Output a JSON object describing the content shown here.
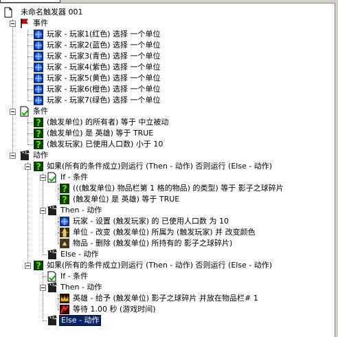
{
  "window": {
    "title": ""
  },
  "tree": {
    "root": {
      "label": "未命名触发器 001"
    },
    "events": {
      "label": "事件",
      "items": [
        "玩家 - 玩家1(红色) 选择 一个单位",
        "玩家 - 玩家2(蓝色) 选择 一个单位",
        "玩家 - 玩家3(青色) 选择 一个单位",
        "玩家 - 玩家4(紫色) 选择 一个单位",
        "玩家 - 玩家5(黄色) 选择 一个单位",
        "玩家 - 玩家6(橙色) 选择 一个单位",
        "玩家 - 玩家7(绿色) 选择 一个单位"
      ]
    },
    "conditions": {
      "label": "条件",
      "items": [
        "(触发单位) 的所有者) 等于 中立被动",
        "(触发单位) 是 英雄) 等于 TRUE",
        "(触发玩家) 已使用人口数) 小于 10"
      ]
    },
    "actions": {
      "label": "动作",
      "if1": {
        "label": "如果(所有的条件成立)则运行 (Then - 动作) 否则运行 (Else - 动作)",
        "if_label": "If - 条件",
        "if_items": [
          "(((触发单位) 物品栏第 1 格的物品) 的类型) 等于 影子之球碎片",
          "(触发单位) 是 英雄) 等于 TRUE"
        ],
        "then_label": "Then - 动作",
        "then_items": [
          "玩家 - 设置 (触发玩家) 的 已使用人口数 为 10",
          "单位 - 改变 (触发单位) 所属为 (触发玩家) 并 改变颜色",
          "物品 - 删除 (触发单位) 所持有的 影子之球碎片)"
        ],
        "else_label": "Else - 动作"
      },
      "if2": {
        "label": "如果(所有的条件成立)则运行 (Then - 动作) 否则运行 (Else - 动作)",
        "if_label": "If - 条件",
        "then_label": "Then - 动作",
        "then_items": [
          "英雄 - 给予 (触发单位) 影子之球碎片 并放在物品栏# 1",
          "等待 1.00 秒 (游戏时间)"
        ],
        "else_label": "Else - 动作"
      }
    }
  },
  "colors": {
    "selection_bg": "#0a246a",
    "tree_line": "#808080",
    "window_face": "#d4d0c8"
  }
}
